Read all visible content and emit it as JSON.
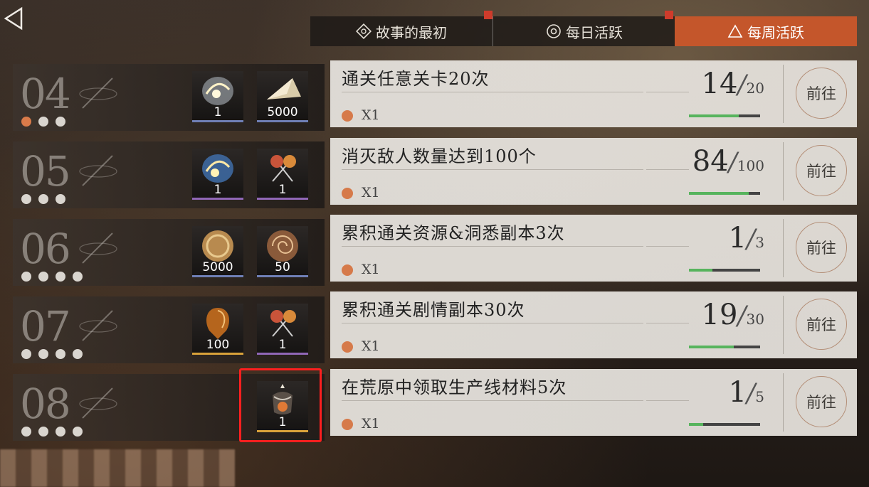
{
  "tabs": [
    {
      "label": "故事的最初",
      "icon": "diamond-target-icon",
      "active": false,
      "notification": true
    },
    {
      "label": "每日活跃",
      "icon": "circle-target-icon",
      "active": false,
      "notification": false
    },
    {
      "label": "每周活跃",
      "icon": "triangle-icon",
      "active": true,
      "notification": true
    }
  ],
  "colors": {
    "accent": "#c4562b",
    "reward_dot": "#d67a4a",
    "progress_green": "#57b45d",
    "highlight": "#ff1f1f"
  },
  "tiers": [
    {
      "num": "04",
      "dots": 3,
      "active_dot": 0,
      "rewards": [
        {
          "icon": "glowing-orb-icon",
          "qty": "1",
          "rarity": "#6f7fb6"
        },
        {
          "icon": "crystal-shard-icon",
          "qty": "5000",
          "rarity": "#6f7fb6"
        }
      ]
    },
    {
      "num": "05",
      "dots": 3,
      "active_dot": -1,
      "rewards": [
        {
          "icon": "glowing-orb-icon",
          "qty": "1",
          "rarity": "#9067b7"
        },
        {
          "icon": "crossed-candies-icon",
          "qty": "1",
          "rarity": "#9067b7"
        }
      ]
    },
    {
      "num": "06",
      "dots": 4,
      "active_dot": -1,
      "rewards": [
        {
          "icon": "gold-coin-icon",
          "qty": "5000",
          "rarity": "#6f7fb6"
        },
        {
          "icon": "ammonite-fossil-icon",
          "qty": "50",
          "rarity": "#6f7fb6"
        }
      ]
    },
    {
      "num": "07",
      "dots": 4,
      "active_dot": -1,
      "rewards": [
        {
          "icon": "amber-gem-icon",
          "qty": "100",
          "rarity": "#d9a23a"
        },
        {
          "icon": "crossed-candies-icon",
          "qty": "1",
          "rarity": "#9067b7"
        }
      ]
    },
    {
      "num": "08",
      "dots": 4,
      "active_dot": -1,
      "rewards": [
        {
          "icon": "ornate-lantern-icon",
          "qty": "1",
          "rarity": "#d9a23a"
        }
      ]
    }
  ],
  "quests": [
    {
      "title": "通关任意关卡20次",
      "reward": "X1",
      "current": "14",
      "total": "20",
      "progress": 0.7,
      "button": "前往"
    },
    {
      "title": "消灭敌人数量达到100个",
      "reward": "X1",
      "current": "84",
      "total": "100",
      "progress": 0.84,
      "button": "前往"
    },
    {
      "title": "累积通关资源&洞悉副本3次",
      "reward": "X1",
      "current": "1",
      "total": "3",
      "progress": 0.333,
      "button": "前往"
    },
    {
      "title": "累积通关剧情副本30次",
      "reward": "X1",
      "current": "19",
      "total": "30",
      "progress": 0.633,
      "button": "前往"
    },
    {
      "title": "在荒原中领取生产线材料5次",
      "reward": "X1",
      "current": "1",
      "total": "5",
      "progress": 0.2,
      "button": "前往"
    }
  ]
}
